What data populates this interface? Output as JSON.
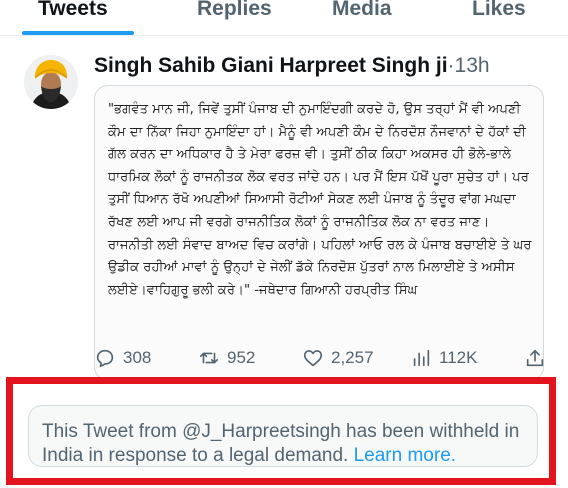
{
  "tabs": [
    {
      "label": "Tweets",
      "active": true
    },
    {
      "label": "Replies",
      "active": false
    },
    {
      "label": "Media",
      "active": false
    },
    {
      "label": "Likes",
      "active": false
    }
  ],
  "tweet": {
    "author_name": "Singh Sahib Giani Harpreet Singh ji",
    "separator": "·",
    "time": "13h",
    "text": "\"ਭਗਵੰਤ ਮਾਨ ਜੀ, ਜਿਵੇਂ ਤੁਸੀਂ ਪੰਜਾਬ ਦੀ ਨੁਮਾਇੰਦਗੀ ਕਰਦੇ ਹੋ, ਉਸ ਤਰ੍ਹਾਂ ਮੈਂ ਵੀ ਅਪਣੀ ਕੌਮ ਦਾ ਨਿੱਕਾ ਜਿਹਾ ਨੁਮਾਇੰਦਾ ਹਾਂ। ਮੈਨੂੰ ਵੀ ਅਪਣੀ ਕੌਮ ਦੇ ਨਿਰਦੋਸ਼ ਨੌਜਵਾਨਾਂ ਦੇ ਹੱਕਾਂ ਦੀ ਗੱਲ ਕਰਨ ਦਾ ਅਧਿਕਾਰ ਹੈ ਤੇ ਮੇਰਾ ਫਰਜ਼ ਵੀ। ਤੁਸੀਂ ਠੀਕ ਕਿਹਾ ਅਕਸਰ ਹੀ ਭੋਲੇ-ਭਾਲੇ ਧਾਰਮਿਕ ਲੋਕਾਂ ਨੂੰ ਰਾਜਨੀਤਕ ਲੋਕ ਵਰਤ ਜਾਂਦੇ ਹਨ। ਪਰ ਮੈਂ ਇਸ ਪੱਖੋਂ ਪੂਰਾ ਸੁਚੇਤ ਹਾਂ। ਪਰ ਤੁਸੀਂ ਧਿਆਨ ਰੱਖੋ ਅਪਣੀਆਂ ਸਿਆਸੀ ਰੋਟੀਆਂ ਸੇਕਣ ਲਈ ਪੰਜਾਬ ਨੂੰ ਤੰਦੂਰ ਵਾਂਗ ਮਘਦਾ ਰੱਖਣ ਲਈ ਆਪ ਜੀ ਵਰਗੇ ਰਾਜਨੀਤਿਕ ਲੋਕਾਂ ਨੂੰ ਰਾਜਨੀਤਿਕ ਲੋਕ ਨਾ ਵਰਤ ਜਾਣ। ਰਾਜਨੀਤੀ ਲਈ ਸੰਵਾਦ ਬਾਅਦ ਵਿਚ ਕਰਾਂਗੇ। ਪਹਿਲਾਂ ਆਓ ਰਲ ਕੇ ਪੰਜਾਬ ਬਚਾਈਏ ਤੇ ਘਰ ਉਡੀਕ ਰਹੀਆਂ ਮਾਵਾਂ ਨੂੰ ਉਨ੍ਹਾਂ ਦੇ ਜੇਲੀਂ ਡੱਕੇ ਨਿਰਦੋਸ਼ ਪੁੱਤਰਾਂ ਨਾਲ ਮਿਲਾਈਏ ਤੇ ਅਸੀਸ ਲਈਏ।ਵਾਹਿਗੁਰੂ ਭਲੀ ਕਰੇ।\"  -ਜਥੇਦਾਰ ਗਿਆਨੀ ਹਰਪ੍ਰੀਤ ਸਿੰਘ",
    "actions": {
      "replies": "308",
      "retweets": "952",
      "likes": "2,257",
      "views": "112K"
    },
    "icons": {
      "reply": "reply-icon",
      "retweet": "retweet-icon",
      "like": "heart-icon",
      "views": "views-icon",
      "share": "share-icon"
    }
  },
  "withheld_notice": {
    "text": "This Tweet from @J_Harpreetsingh has been withheld in India in response to a legal demand.",
    "link": "Learn more."
  },
  "colors": {
    "accent": "#1d9bf0",
    "highlight_frame": "#e3141e",
    "muted_text": "#536471",
    "avatar_turban": "#f4b400"
  }
}
